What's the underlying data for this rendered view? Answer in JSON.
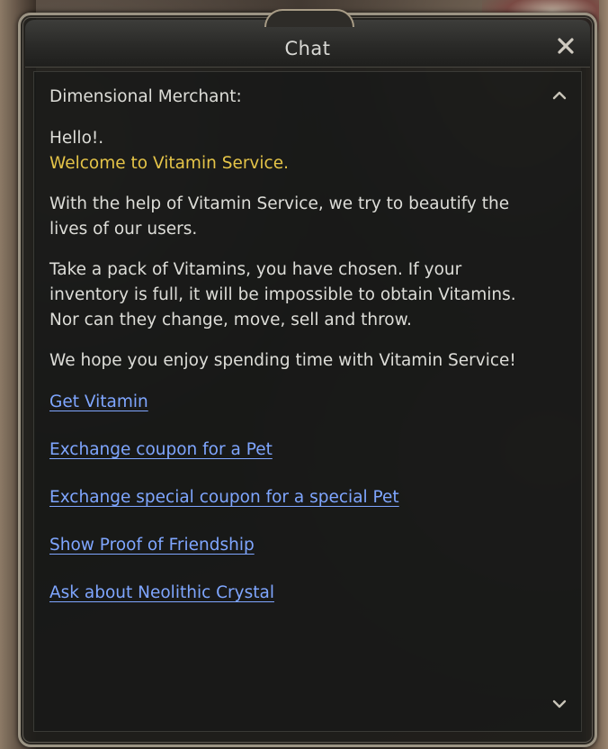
{
  "window": {
    "title": "Chat",
    "close_icon": "close-icon"
  },
  "dialog": {
    "speaker": "Dimensional Merchant:",
    "greeting": "Hello!.",
    "welcome": "Welcome to Vitamin Service.",
    "paragraph1": "With the help of Vitamin Service, we try to beautify the lives of our users.",
    "paragraph2": "Take a pack of Vitamins, you have chosen. If your inventory is full, it will be impossible to obtain Vitamins. Nor can they change, move, sell and throw.",
    "paragraph3": "We hope you enjoy spending time with Vitamin Service!",
    "links": [
      "Get Vitamin",
      "Exchange coupon for a Pet",
      "Exchange special coupon for a special Pet",
      "Show Proof of Friendship",
      "Ask about Neolithic Crystal"
    ]
  },
  "colors": {
    "text": "#ddddd8",
    "highlight": "#e5c448",
    "link": "#7fa6ff"
  },
  "icons": {
    "scroll_up": "chevron-up-icon",
    "scroll_down": "chevron-down-icon"
  }
}
